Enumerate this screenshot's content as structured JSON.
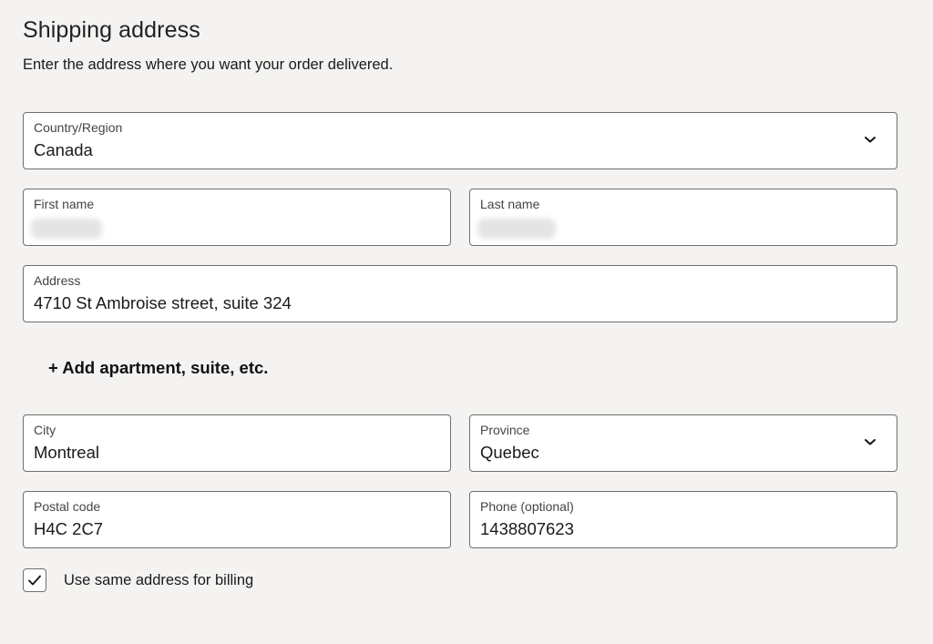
{
  "header": {
    "title": "Shipping address",
    "subtitle": "Enter the address where you want your order delivered."
  },
  "form": {
    "country": {
      "label": "Country/Region",
      "value": "Canada",
      "icon": "chevron-down-icon"
    },
    "first_name": {
      "label": "First name",
      "value": ""
    },
    "last_name": {
      "label": "Last name",
      "value": ""
    },
    "address": {
      "label": "Address",
      "value": "4710 St Ambroise street, suite 324"
    },
    "add_apartment_label": "+ Add apartment, suite, etc.",
    "city": {
      "label": "City",
      "value": "Montreal"
    },
    "province": {
      "label": "Province",
      "value": "Quebec",
      "icon": "chevron-down-icon"
    },
    "postal_code": {
      "label": "Postal code",
      "value": "H4C 2C7"
    },
    "phone": {
      "label": "Phone (optional)",
      "value": "1438807623"
    },
    "billing_checkbox": {
      "label": "Use same address for billing",
      "checked": true,
      "icon": "checkmark-icon"
    }
  },
  "colors": {
    "background": "#f4f3f1",
    "field_background": "#ffffff",
    "field_border": "#6f6f6f",
    "text": "#1a1a1a"
  }
}
